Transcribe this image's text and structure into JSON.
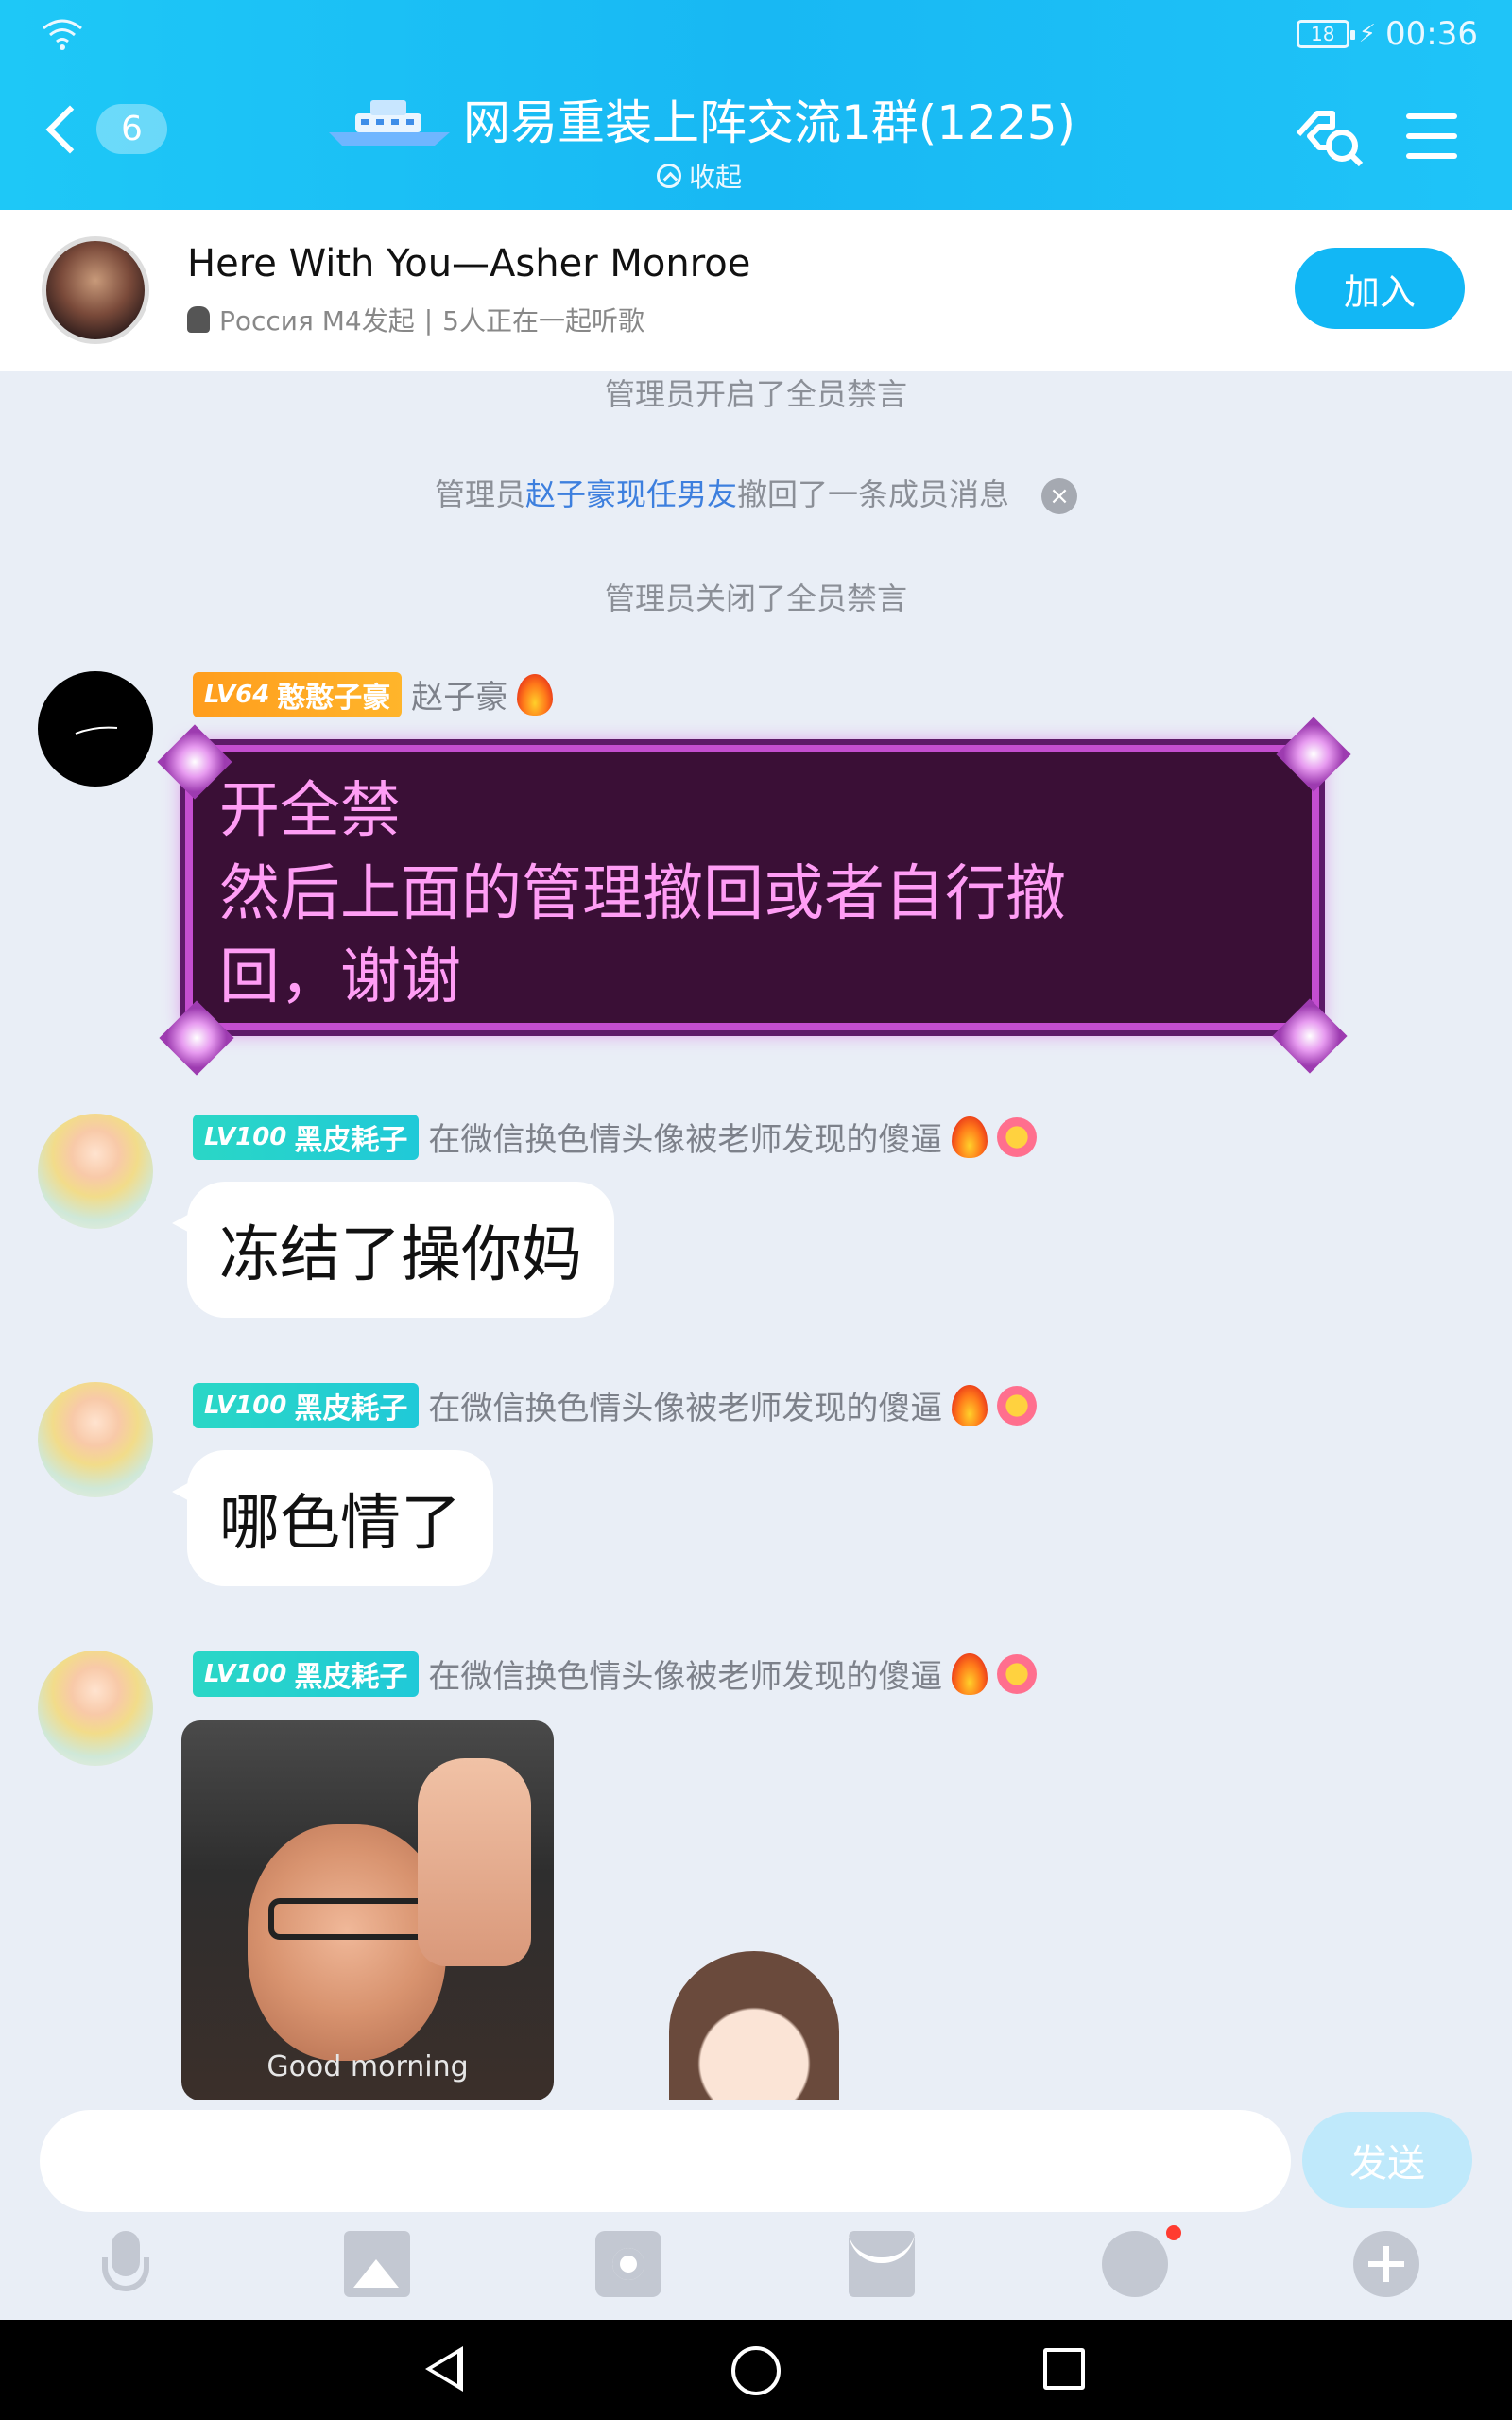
{
  "status_bar": {
    "battery": "18",
    "time": "00:36"
  },
  "header": {
    "back_badge": "6",
    "title": "网易重装上阵交流1群(1225)",
    "collapse_label": "收起"
  },
  "music": {
    "song": "Here With You—Asher Monroe",
    "initiator": "Россия М4发起",
    "separator": "|",
    "listeners": "5人正在一起听歌",
    "join_label": "加入"
  },
  "system_messages": {
    "mute_on": "管理员开启了全员禁言",
    "recall_prefix": "管理员",
    "recall_admin": "赵子豪现任男友",
    "recall_suffix": "撤回了一条成员消息",
    "mute_off": "管理员关闭了全员禁言"
  },
  "messages": [
    {
      "level": "LV64",
      "title": "憨憨子豪",
      "name": "赵子豪",
      "text_lines": [
        "开全禁",
        "然后上面的管理撤回或者自行撤",
        "回，谢谢"
      ]
    },
    {
      "level": "LV100",
      "title": "黑皮耗子",
      "name": "在微信换色情头像被老师发现的傻逼",
      "text": "冻结了操你妈"
    },
    {
      "level": "LV100",
      "title": "黑皮耗子",
      "name": "在微信换色情头像被老师发现的傻逼",
      "text": "哪色情了"
    },
    {
      "level": "LV100",
      "title": "黑皮耗子",
      "name": "在微信换色情头像被老师发现的傻逼",
      "image_caption": "Good morning"
    }
  ],
  "input": {
    "placeholder": "",
    "send_label": "发送"
  },
  "colors": {
    "header": "#1ec8f7",
    "accent": "#12b7f5",
    "bubble_fancy": "#3a0f36",
    "fancy_text": "#ff9df5",
    "badge_teal": "#2ad7c6",
    "badge_orange": "#ff9d1d"
  }
}
